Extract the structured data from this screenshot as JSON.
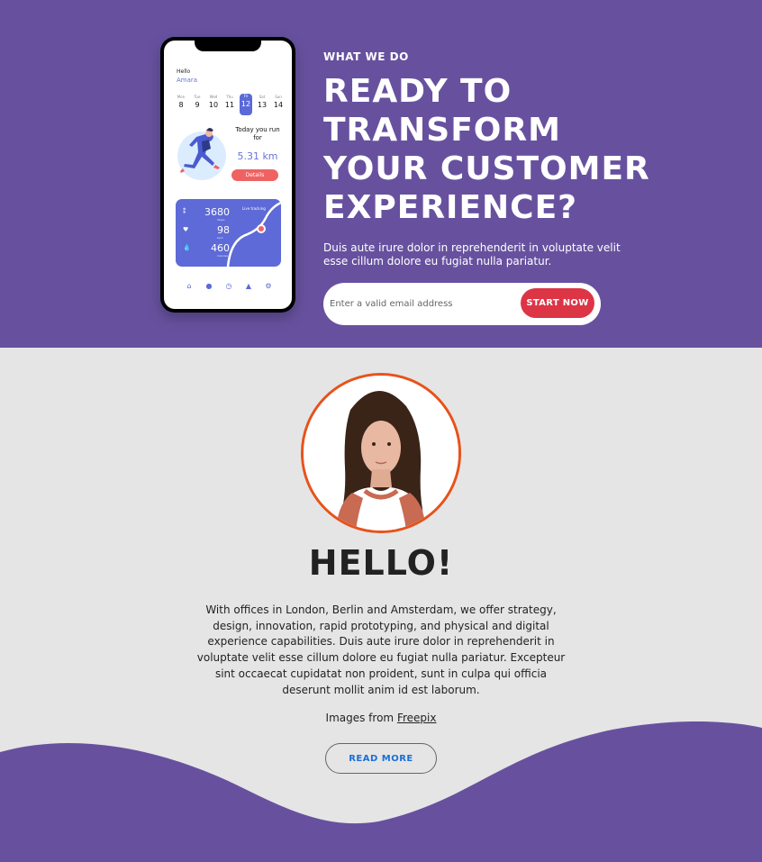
{
  "hero": {
    "eyebrow": "WHAT WE DO",
    "title_lines": [
      "READY TO",
      "TRANSFORM",
      "YOUR CUSTOMER",
      "EXPERIENCE?"
    ],
    "description": "Duis aute irure dolor in reprehenderit in voluptate velit esse cillum dolore eu fugiat nulla pariatur.",
    "email_placeholder": "Enter a valid email address",
    "cta_label": "START NOW",
    "background_color": "#67519f"
  },
  "phone": {
    "greeting": "Hello",
    "user_name": "Amara",
    "days": [
      {
        "name": "Mon",
        "date": "8"
      },
      {
        "name": "Tue",
        "date": "9"
      },
      {
        "name": "Wed",
        "date": "10"
      },
      {
        "name": "Thu",
        "date": "11"
      },
      {
        "name": "Fri",
        "date": "12"
      },
      {
        "name": "Sat",
        "date": "13"
      },
      {
        "name": "Sun",
        "date": "14"
      }
    ],
    "active_day_index": 4,
    "run_title": "Today you run for",
    "run_distance": "5.31 km",
    "details_label": "Details",
    "live_label": "Live tracking",
    "stats": [
      {
        "icon": "footsteps-icon",
        "value": "3680",
        "label": "Steps"
      },
      {
        "icon": "heart-icon",
        "value": "98",
        "label": "bpm"
      },
      {
        "icon": "drop-icon",
        "value": "460",
        "label": "Calories"
      }
    ],
    "nav_icons": [
      "home-icon",
      "user-icon",
      "clock-icon",
      "bell-icon",
      "gear-icon"
    ]
  },
  "about": {
    "heading": "HELLO!",
    "body": "With offices in London, Berlin and Amsterdam, we offer strategy, design, innovation, rapid prototyping, and physical and digital experience capabilities. Duis aute irure dolor in reprehenderit in voluptate velit esse cillum dolore eu fugiat nulla pariatur. Excepteur sint occaecat cupidatat non proident, sunt in culpa qui officia deserunt mollit anim id est laborum.",
    "credit_prefix": "Images from",
    "credit_link": "Freepix",
    "read_more_label": "READ MORE",
    "avatar_border_color": "#e8521a"
  },
  "colors": {
    "accent": "#dc3545",
    "link": "#1a6fd6",
    "app_blue": "#5d6ad7"
  }
}
